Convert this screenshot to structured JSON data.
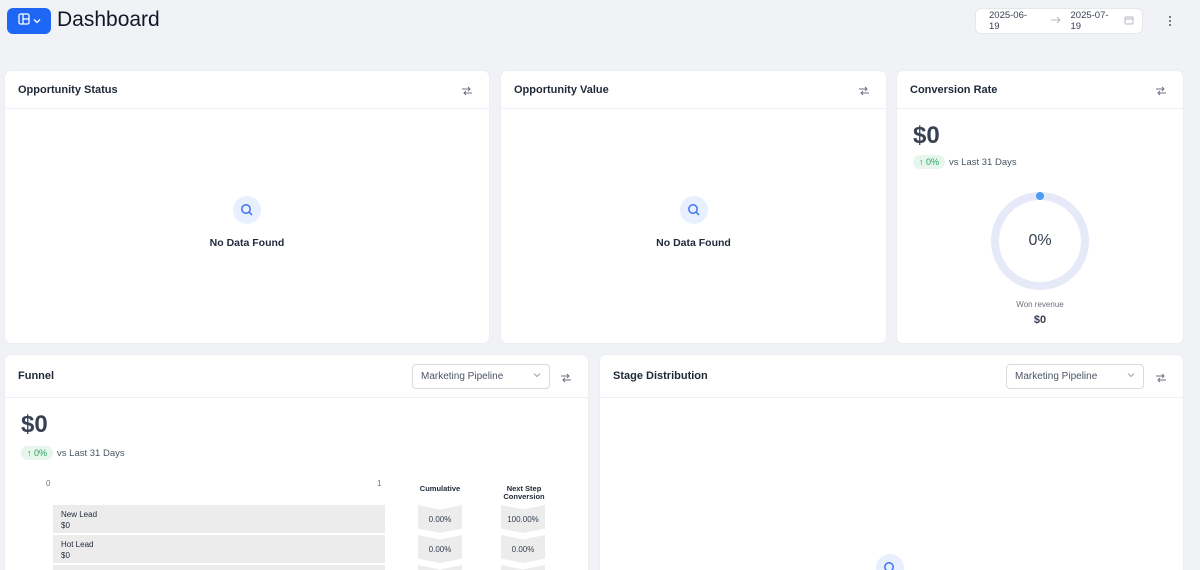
{
  "header": {
    "title": "Dashboard",
    "date_start": "2025-06-19",
    "date_end": "2025-07-19"
  },
  "opportunity_status": {
    "title": "Opportunity Status",
    "empty_text": "No Data Found"
  },
  "opportunity_value": {
    "title": "Opportunity Value",
    "empty_text": "No Data Found"
  },
  "conversion_rate": {
    "title": "Conversion Rate",
    "value": "$0",
    "trend": "↑ 0%",
    "trend_label": "vs Last 31 Days",
    "gauge_percent": "0%",
    "gauge_value": 0,
    "won_label": "Won revenue",
    "won_value": "$0"
  },
  "funnel": {
    "title": "Funnel",
    "pipeline": "Marketing Pipeline",
    "value": "$0",
    "trend": "↑ 0%",
    "trend_label": "vs Last 31 Days",
    "axis_min": "0",
    "axis_max": "1",
    "cumulative_header": "Cumulative",
    "next_step_header_1": "Next Step",
    "next_step_header_2": "Conversion",
    "stages": [
      {
        "name": "New Lead",
        "value": "$0",
        "cumulative": "0.00%",
        "next_step": "100.00%"
      },
      {
        "name": "Hot Lead",
        "value": "$0",
        "cumulative": "0.00%",
        "next_step": "0.00%"
      },
      {
        "name": "",
        "value": "",
        "cumulative": "",
        "next_step": ""
      }
    ]
  },
  "stage_distribution": {
    "title": "Stage Distribution",
    "pipeline": "Marketing Pipeline"
  },
  "colors": {
    "accent": "#1e66f5",
    "trend_green": "#22a35a",
    "gauge_track": "#e6eaf8",
    "gauge_dot": "#4b9cf5"
  }
}
